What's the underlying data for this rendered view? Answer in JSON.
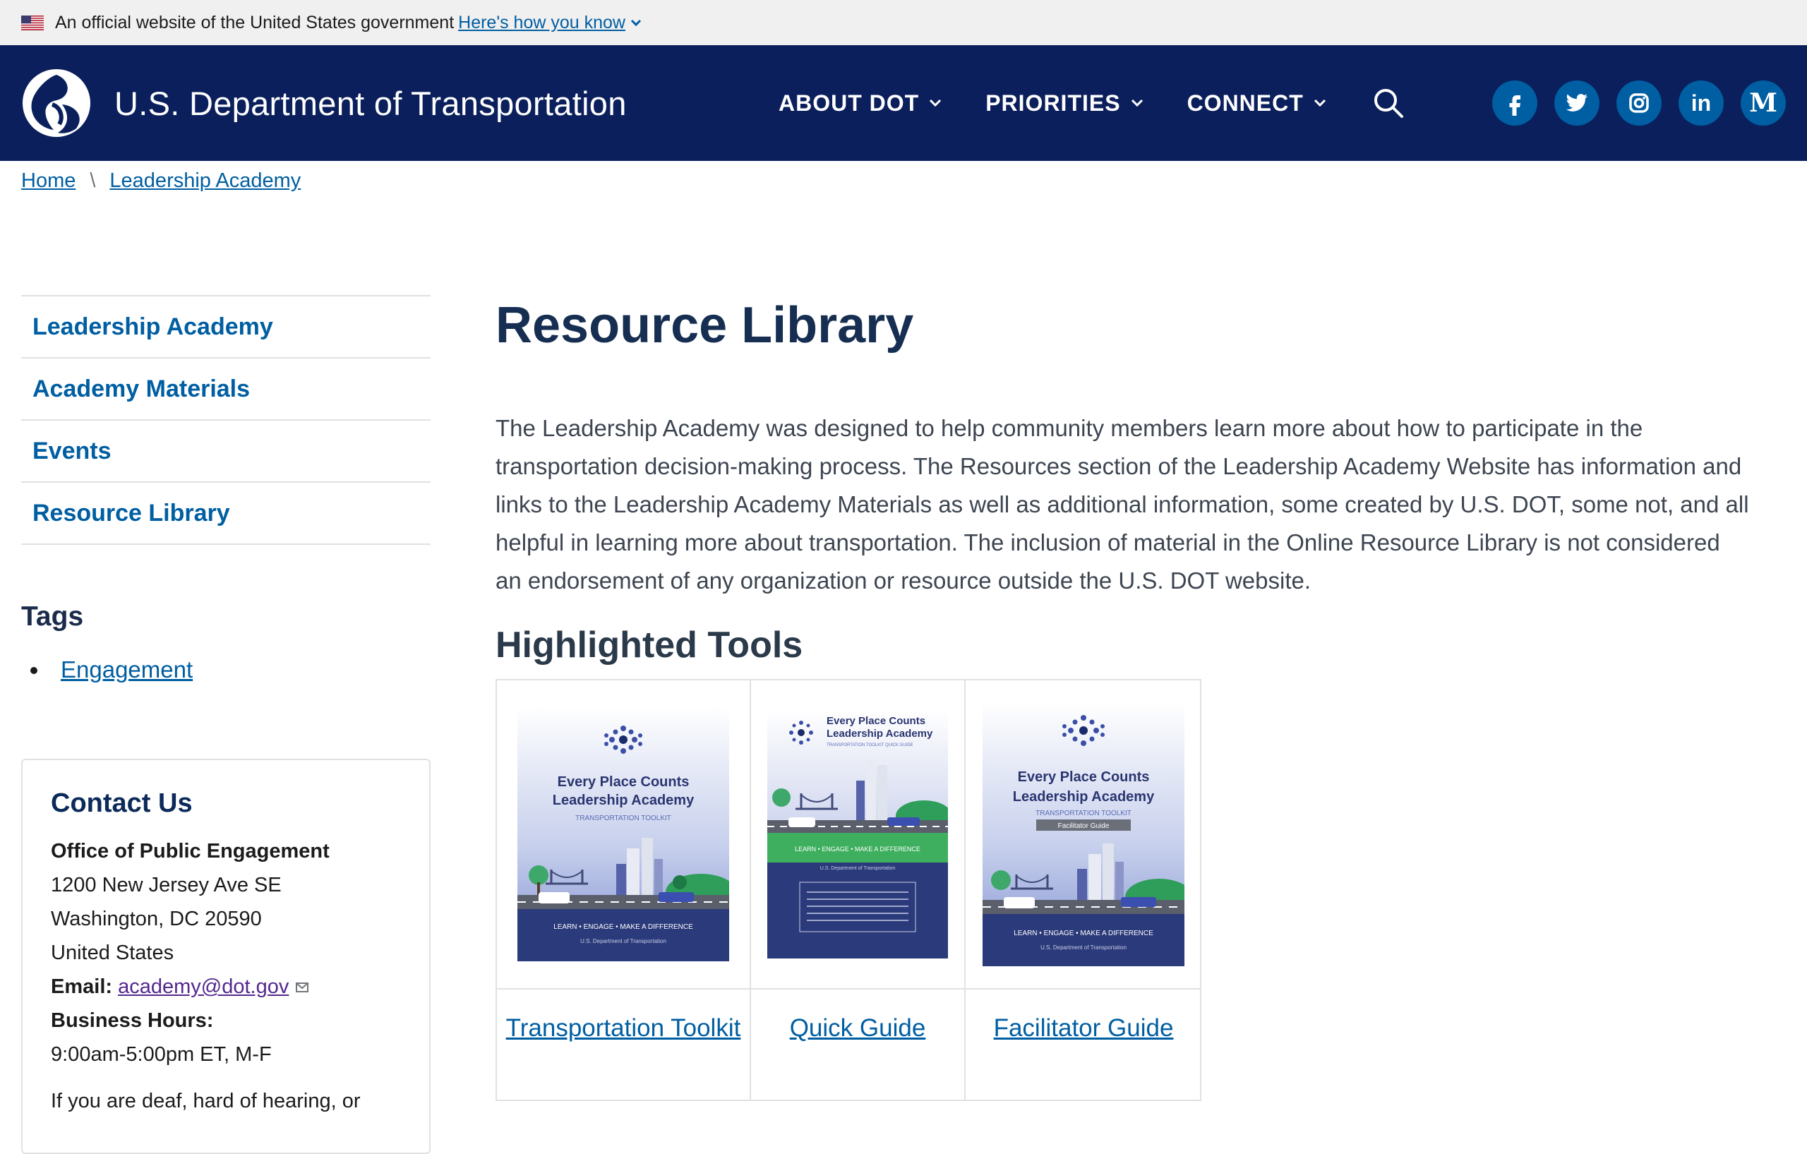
{
  "gov_banner": {
    "text": "An official website of the United States government",
    "link": "Here's how you know"
  },
  "header": {
    "site_title": "U.S. Department of Transportation",
    "nav": [
      {
        "label": "ABOUT DOT"
      },
      {
        "label": "PRIORITIES"
      },
      {
        "label": "CONNECT"
      }
    ],
    "social": [
      "facebook-icon",
      "twitter-icon",
      "instagram-icon",
      "linkedin-icon",
      "medium-icon"
    ],
    "colors": {
      "header_bg": "#0b1f5c",
      "social_bg": "#005ea2"
    }
  },
  "breadcrumb": [
    {
      "label": "Home"
    },
    {
      "label": "Leadership Academy"
    }
  ],
  "sidenav": [
    {
      "label": "Leadership Academy"
    },
    {
      "label": "Academy Materials"
    },
    {
      "label": "Events"
    },
    {
      "label": "Resource Library"
    }
  ],
  "tags": {
    "heading": "Tags",
    "items": [
      {
        "label": "Engagement"
      }
    ]
  },
  "contact": {
    "title": "Contact Us",
    "office": "Office of Public Engagement",
    "address1": "1200 New Jersey Ave SE",
    "address2": "Washington, DC 20590",
    "country": "United States",
    "email_label": "Email:",
    "email": "academy@dot.gov",
    "hours_label": "Business Hours:",
    "hours": "9:00am-5:00pm ET, M-F",
    "deaf_text": "If you are deaf, hard of hearing, or"
  },
  "main": {
    "title": "Resource Library",
    "intro": "The Leadership Academy was designed to help community members learn more about how to participate in the transportation decision-making process.  The Resources section of the Leadership Academy Website has information and links to the Leadership Academy Materials as well as additional information, some created by U.S. DOT, some not,  and all helpful in learning more about transportation. The inclusion of material in the Online Resource Library is not considered an endorsement of any organization or resource outside the U.S. DOT website.",
    "section_title": "Highlighted Tools",
    "tools": [
      {
        "caption": "Transportation Toolkit",
        "cover_title1": "Every Place Counts",
        "cover_title2": "Leadership Academy",
        "cover_sub": "TRANSPORTATION TOOLKIT",
        "cover_tagline": "LEARN • ENGAGE • MAKE A DIFFERENCE",
        "cover_footer": "U.S. Department of Transportation"
      },
      {
        "caption": "Quick Guide",
        "cover_title1": "Every Place Counts",
        "cover_title2": "Leadership Academy",
        "cover_sub": "TRANSPORTATION TOOLKIT QUICK GUIDE",
        "cover_tagline": "LEARN • ENGAGE • MAKE A DIFFERENCE",
        "cover_footer": "U.S. Department of Transportation"
      },
      {
        "caption": "Facilitator Guide",
        "cover_title1": "Every Place Counts",
        "cover_title2": "Leadership Academy",
        "cover_sub": "TRANSPORTATION TOOLKIT",
        "cover_badge": "Facilitator Guide",
        "cover_tagline": "LEARN • ENGAGE • MAKE A DIFFERENCE",
        "cover_footer": "U.S. Department of Transportation"
      }
    ]
  }
}
